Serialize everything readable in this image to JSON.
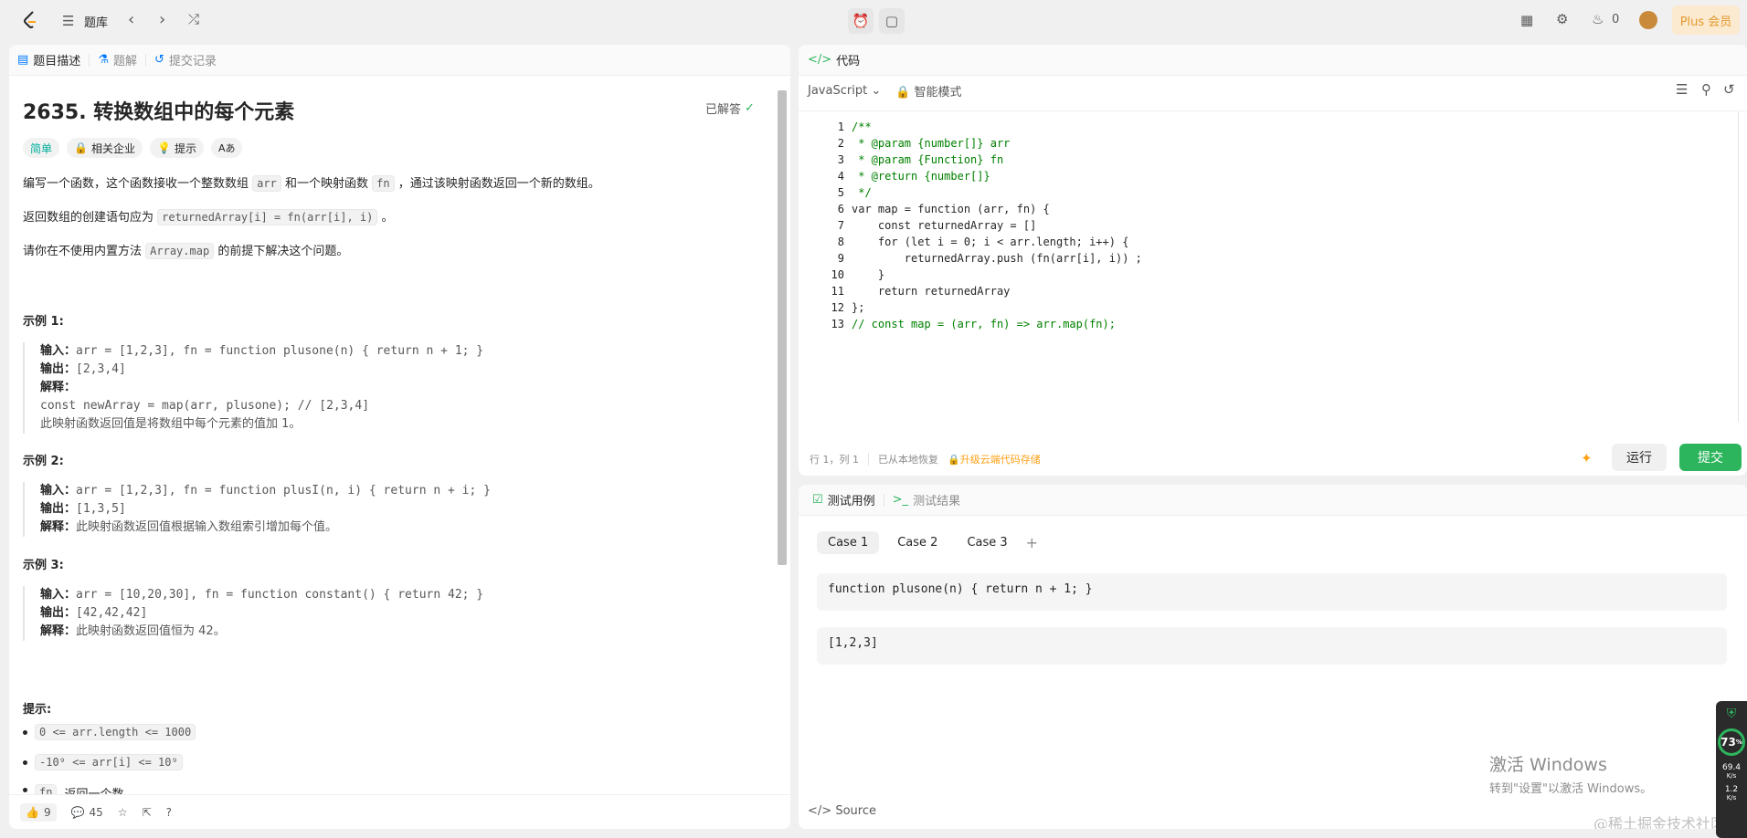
{
  "topbar": {
    "title": "题库",
    "plus": "Plus 会员",
    "coins": "0"
  },
  "left": {
    "tabs": [
      "题目描述",
      "题解",
      "提交记录"
    ],
    "problem_title": "2635. 转换数组中的每个元素",
    "solved": "已解答",
    "tags": [
      "简单",
      "相关企业",
      "提示",
      "Aあ"
    ],
    "desc1_a": "编写一个函数，这个函数接收一个整数数组",
    "desc1_b": "arr",
    "desc1_c": "和一个映射函数",
    "desc1_d": "fn",
    "desc1_e": "，通过该映射函数返回一个新的数组。",
    "desc2_a": "返回数组的创建语句应为",
    "desc2_b": "returnedArray[i] = fn(arr[i], i)",
    "desc2_c": "。",
    "desc3_a": "请你在不使用内置方法",
    "desc3_b": "Array.map",
    "desc3_c": "的前提下解决这个问题。",
    "examples": [
      {
        "title": "示例 1:",
        "in_label": "输入：",
        "in": "arr = [1,2,3], fn = function plusone(n) { return n + 1; }",
        "out_label": "输出：",
        "out": "[2,3,4]",
        "exp_label": "解释：",
        "exp1": "const newArray = map(arr, plusone); // [2,3,4]",
        "exp2": "此映射函数返回值是将数组中每个元素的值加 1。"
      },
      {
        "title": "示例 2:",
        "in_label": "输入：",
        "in": "arr = [1,2,3], fn = function plusI(n, i) { return n + i; }",
        "out_label": "输出：",
        "out": "[1,3,5]",
        "exp_label": "解释：",
        "exp": "此映射函数返回值根据输入数组索引增加每个值。"
      },
      {
        "title": "示例 3:",
        "in_label": "输入：",
        "in": "arr = [10,20,30], fn = function constant() { return 42; }",
        "out_label": "输出：",
        "out": "[42,42,42]",
        "exp_label": "解释：",
        "exp": "此映射函数返回值恒为 42。"
      }
    ],
    "hints_title": "提示:",
    "hints": [
      "0 <= arr.length <= 1000",
      "-10⁹ <= arr[i] <= 10⁹",
      "fn"
    ],
    "hint3_tail": "返回一个数",
    "likes": "9",
    "comments": "45"
  },
  "editor": {
    "title": "代码",
    "lang": "JavaScript",
    "mode": "智能模式",
    "lines": [
      "/**",
      " * @param {number[]} arr",
      " * @param {Function} fn",
      " * @return {number[]}",
      " */",
      "var map = function (arr, fn) {",
      "    const returnedArray = []",
      "    for (let i = 0; i < arr.length; i++) {",
      "        returnedArray.push (fn(arr[i], i)) ;",
      "    }",
      "    return returnedArray",
      "};",
      "// const map = (arr, fn) => arr.map(fn);"
    ],
    "status_pos": "行 1，列 1",
    "status_saved": "已从本地恢复",
    "status_upgrade": "升级云端代码存储",
    "run": "运行",
    "submit": "提交"
  },
  "tests": {
    "tabs": [
      "测试用例",
      "测试结果"
    ],
    "cases": [
      "Case 1",
      "Case 2",
      "Case 3"
    ],
    "input1": "function plusone(n) { return n + 1; }",
    "input2": "[1,2,3]",
    "source": "Source"
  },
  "watermark": {
    "line1": "激活 Windows",
    "line2": "转到\"设置\"以激活 Windows。",
    "credit": "@稀土掘金技术社区"
  },
  "tray": {
    "pct": "73",
    "unit": "%",
    "net1": "69.4",
    "net1u": "K/s",
    "net2": "1.2",
    "net2u": "K/s"
  },
  "colors": {
    "green": "#2db55d",
    "easy": "#00af9b",
    "orange": "#ffa116"
  }
}
